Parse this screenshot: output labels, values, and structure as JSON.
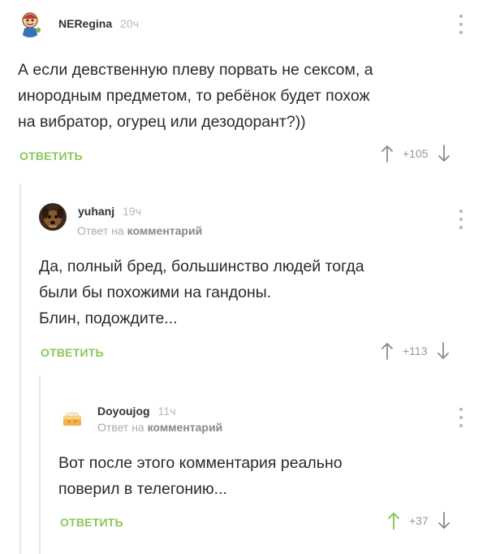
{
  "colors": {
    "accent": "#8ac858",
    "muted": "#aaaaaa",
    "thread_line": "#e6e6e6"
  },
  "comments": [
    {
      "username": "NERegina",
      "time": "20ч",
      "text_lines": [
        "А если девственную плеву порвать не сексом, а",
        "инородным предметом, то ребёнок будет похож",
        "на вибратор, огурец или дезодорант?))"
      ],
      "reply_label": "ОТВЕТИТЬ",
      "rating": "+105",
      "avatar_icon": "cartoon-avatar-icon"
    },
    {
      "username": "yuhanj",
      "time": "19ч",
      "reply_to_prefix": "Ответ на",
      "reply_to_link": "комментарий",
      "text_lines": [
        "Да, полный бред, большинство людей тогда",
        "были бы похожими на гандоны.",
        "Блин, подождите..."
      ],
      "reply_label": "ОТВЕТИТЬ",
      "rating": "+113",
      "avatar_icon": "dog-avatar-icon"
    },
    {
      "username": "Doyoujog",
      "time": "11ч",
      "reply_to_prefix": "Ответ на",
      "reply_to_link": "комментарий",
      "text_lines": [
        "Вот после этого комментария реально",
        "поверил в телегонию..."
      ],
      "reply_label": "ОТВЕТИТЬ",
      "rating": "+37",
      "avatar_icon": "cake-avatar-icon"
    }
  ]
}
